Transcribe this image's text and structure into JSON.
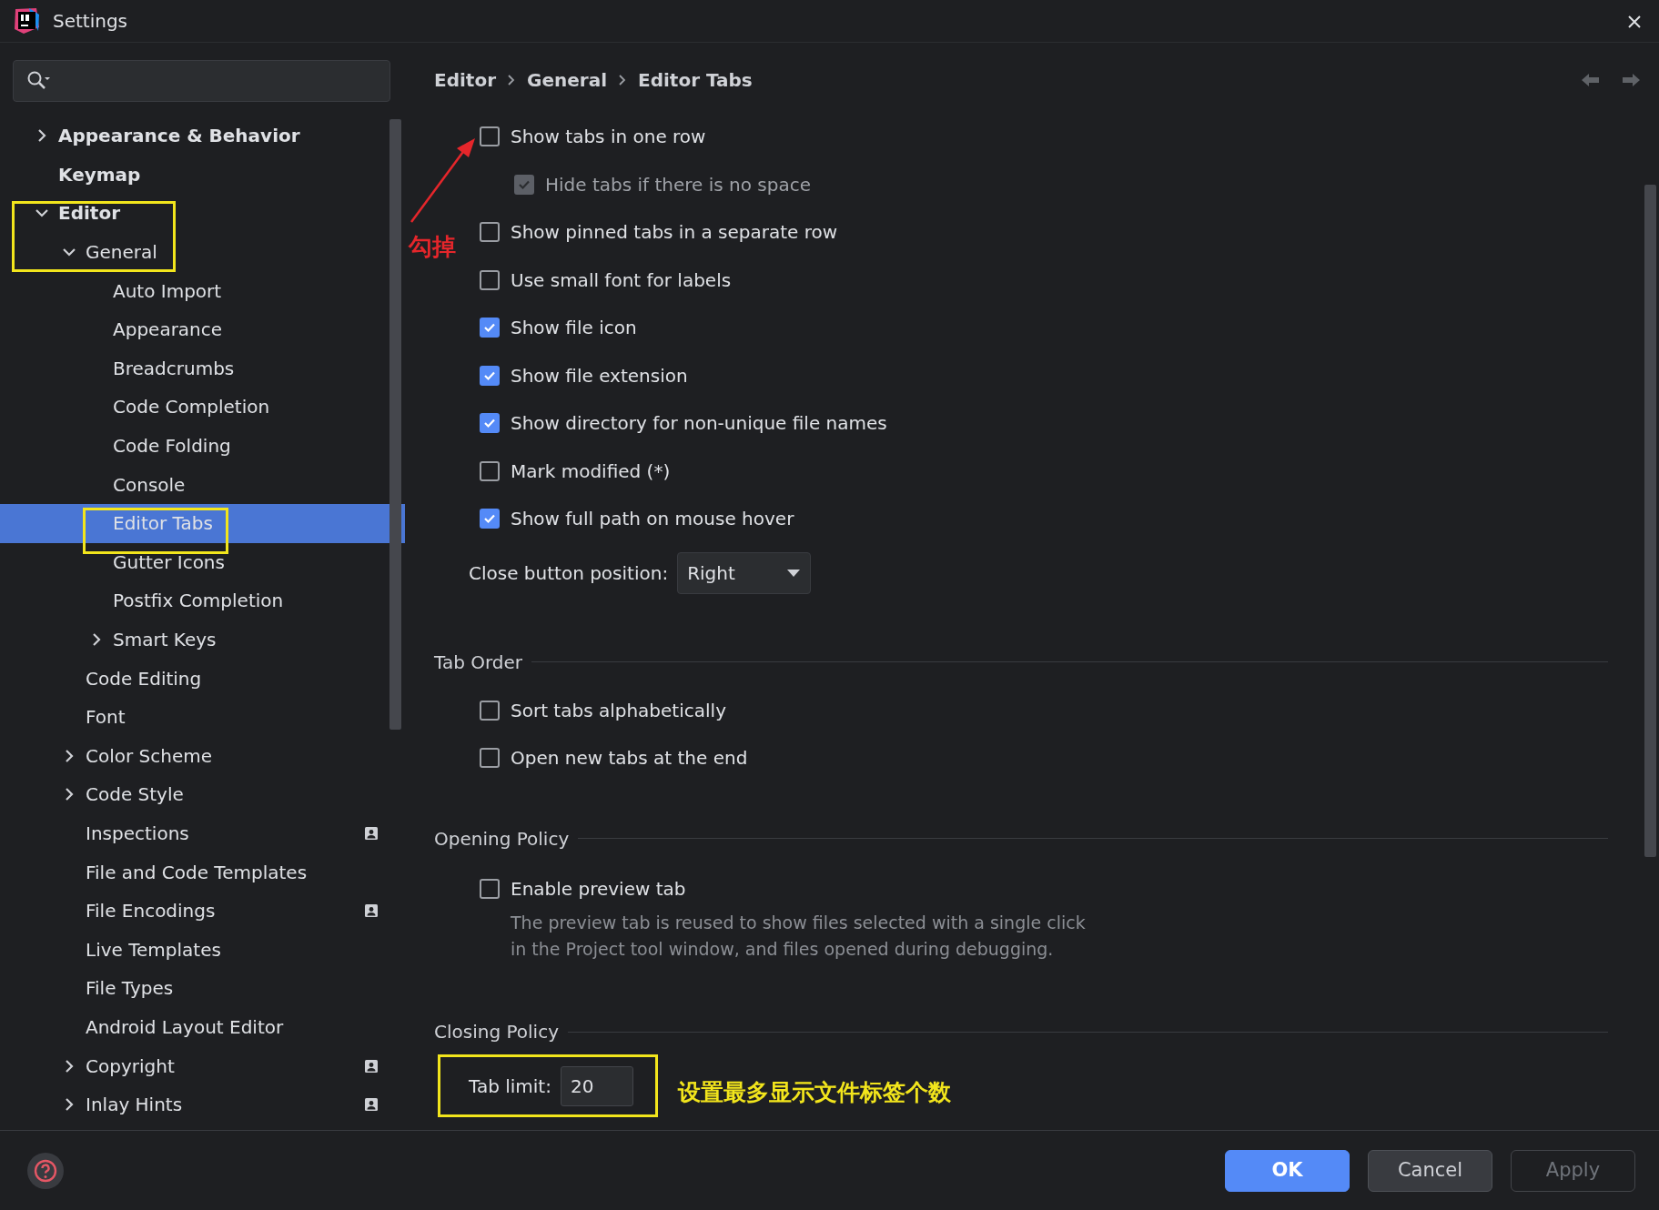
{
  "window": {
    "title": "Settings"
  },
  "tree": [
    {
      "label": "Appearance & Behavior",
      "kind": "group",
      "expanded": false,
      "selected": false,
      "badge": false
    },
    {
      "label": "Keymap",
      "kind": "page",
      "selected": false,
      "badge": false
    },
    {
      "label": "Editor",
      "kind": "group",
      "expanded": true,
      "selected": false,
      "badge": false,
      "children": [
        {
          "label": "General",
          "kind": "group",
          "expanded": true,
          "selected": false,
          "badge": false,
          "children": [
            {
              "label": "Auto Import",
              "kind": "page",
              "selected": false,
              "badge": false
            },
            {
              "label": "Appearance",
              "kind": "page",
              "selected": false,
              "badge": false
            },
            {
              "label": "Breadcrumbs",
              "kind": "page",
              "selected": false,
              "badge": false
            },
            {
              "label": "Code Completion",
              "kind": "page",
              "selected": false,
              "badge": false
            },
            {
              "label": "Code Folding",
              "kind": "page",
              "selected": false,
              "badge": false
            },
            {
              "label": "Console",
              "kind": "page",
              "selected": false,
              "badge": false
            },
            {
              "label": "Editor Tabs",
              "kind": "page",
              "selected": true,
              "badge": false
            },
            {
              "label": "Gutter Icons",
              "kind": "page",
              "selected": false,
              "badge": false
            },
            {
              "label": "Postfix Completion",
              "kind": "page",
              "selected": false,
              "badge": false
            },
            {
              "label": "Smart Keys",
              "kind": "group",
              "expanded": false,
              "selected": false,
              "badge": false
            }
          ]
        },
        {
          "label": "Code Editing",
          "kind": "page",
          "selected": false,
          "badge": false
        },
        {
          "label": "Font",
          "kind": "page",
          "selected": false,
          "badge": false
        },
        {
          "label": "Color Scheme",
          "kind": "group",
          "expanded": false,
          "selected": false,
          "badge": false
        },
        {
          "label": "Code Style",
          "kind": "group",
          "expanded": false,
          "selected": false,
          "badge": false
        },
        {
          "label": "Inspections",
          "kind": "page",
          "selected": false,
          "badge": true
        },
        {
          "label": "File and Code Templates",
          "kind": "page",
          "selected": false,
          "badge": false
        },
        {
          "label": "File Encodings",
          "kind": "page",
          "selected": false,
          "badge": true
        },
        {
          "label": "Live Templates",
          "kind": "page",
          "selected": false,
          "badge": false
        },
        {
          "label": "File Types",
          "kind": "page",
          "selected": false,
          "badge": false
        },
        {
          "label": "Android Layout Editor",
          "kind": "page",
          "selected": false,
          "badge": false
        },
        {
          "label": "Copyright",
          "kind": "group",
          "expanded": false,
          "selected": false,
          "badge": true
        },
        {
          "label": "Inlay Hints",
          "kind": "group",
          "expanded": false,
          "selected": false,
          "badge": true
        }
      ]
    }
  ],
  "breadcrumb": [
    "Editor",
    "General",
    "Editor Tabs"
  ],
  "options": [
    {
      "label": "Show tabs in one row",
      "checked": false,
      "disabled": false,
      "children": [
        {
          "label": "Hide tabs if there is no space",
          "checked": true,
          "disabled": true
        }
      ]
    },
    {
      "label": "Show pinned tabs in a separate row",
      "checked": false,
      "disabled": false
    },
    {
      "label": "Use small font for labels",
      "checked": false,
      "disabled": false
    },
    {
      "label": "Show file icon",
      "checked": true,
      "disabled": false
    },
    {
      "label": "Show file extension",
      "checked": true,
      "disabled": false
    },
    {
      "label": "Show directory for non-unique file names",
      "checked": true,
      "disabled": false
    },
    {
      "label": "Mark modified (*)",
      "checked": false,
      "disabled": false
    },
    {
      "label": "Show full path on mouse hover",
      "checked": true,
      "disabled": false
    }
  ],
  "close_button_position": {
    "label": "Close button position:",
    "value": "Right"
  },
  "tab_order": {
    "title": "Tab Order",
    "options": [
      {
        "label": "Sort tabs alphabetically",
        "checked": false,
        "disabled": false
      },
      {
        "label": "Open new tabs at the end",
        "checked": false,
        "disabled": false
      }
    ]
  },
  "opening_policy": {
    "title": "Opening Policy",
    "options": [
      {
        "label": "Enable preview tab",
        "checked": false,
        "disabled": false
      }
    ],
    "description": [
      "The preview tab is reused to show files selected with a single click",
      "in the Project tool window, and files opened during debugging."
    ]
  },
  "closing_policy": {
    "title": "Closing Policy",
    "tab_limit": {
      "label": "Tab limit:",
      "value": "20"
    }
  },
  "buttons": [
    {
      "label": "OK",
      "kind": "primary",
      "disabled": false
    },
    {
      "label": "Cancel",
      "kind": "secondary",
      "disabled": false
    },
    {
      "label": "Apply",
      "kind": "secondary",
      "disabled": true
    }
  ],
  "annotations": [
    {
      "kind": "frame",
      "color": "#f2e51c"
    },
    {
      "kind": "frame",
      "color": "#f2e51c"
    },
    {
      "kind": "frame",
      "color": "#f2e51c"
    },
    {
      "kind": "arrow",
      "color": "#e5262b"
    },
    {
      "kind": "note",
      "text": "勾掉",
      "color": "#e5262b"
    },
    {
      "kind": "note",
      "text": "设置最多显示文件标签个数",
      "color": "#f2e51c"
    }
  ]
}
